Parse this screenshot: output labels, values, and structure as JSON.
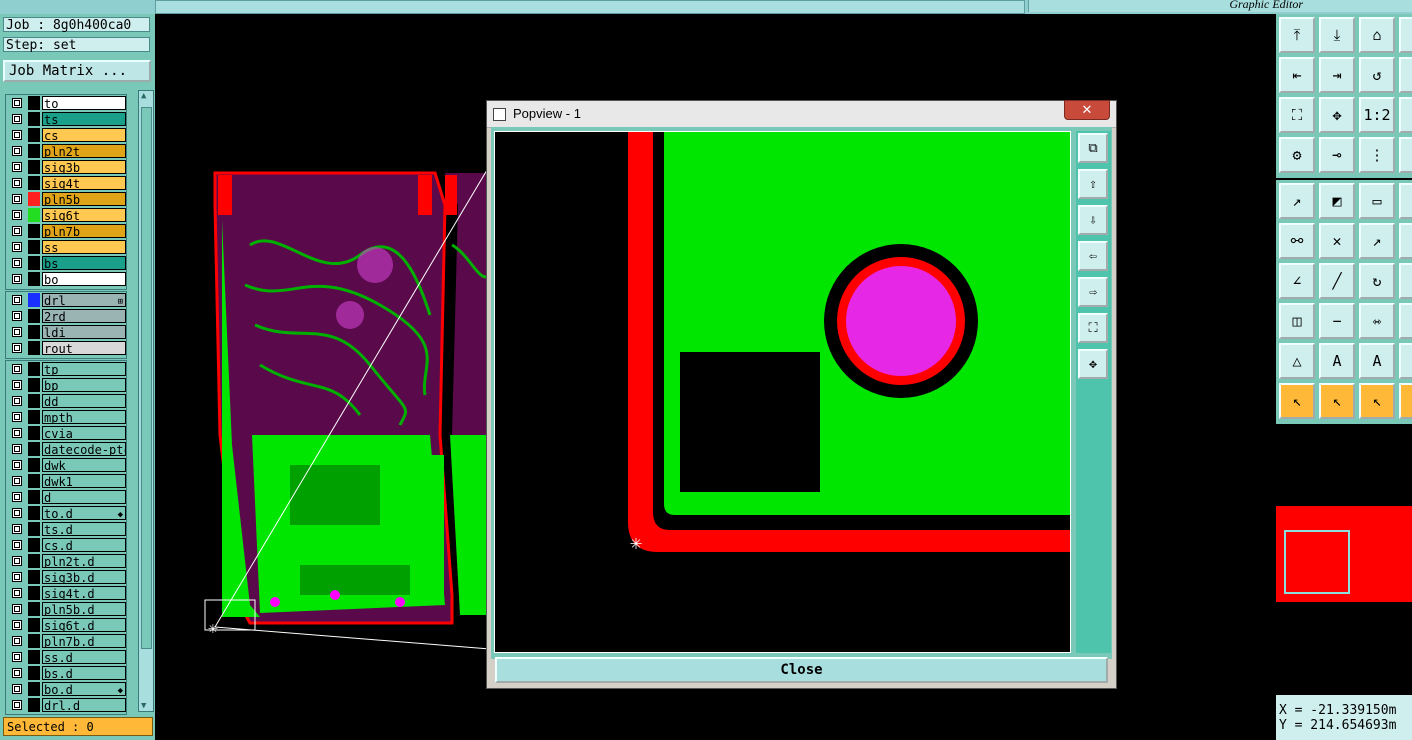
{
  "topbar": {
    "title": "Graphic Editor"
  },
  "left_panel": {
    "job": "Job : 8g0h400ca0",
    "step": "Step: set",
    "job_matrix_button": "Job Matrix ...",
    "layers_top": [
      {
        "name": "to",
        "color": "#ffffff",
        "swatch": "#000000"
      },
      {
        "name": "ts",
        "color": "#1aa08a",
        "swatch": "#000000"
      },
      {
        "name": "cs",
        "color": "#ffc850",
        "swatch": "#000000"
      },
      {
        "name": "pln2t",
        "color": "#e0a418",
        "swatch": "#000000"
      },
      {
        "name": "sig3b",
        "color": "#ffc850",
        "swatch": "#000000"
      },
      {
        "name": "sig4t",
        "color": "#ffc850",
        "swatch": "#000000"
      },
      {
        "name": "pln5b",
        "color": "#e0a418",
        "swatch": "#ff2020"
      },
      {
        "name": "sig6t",
        "color": "#ffc850",
        "swatch": "#22dd22"
      },
      {
        "name": "pln7b",
        "color": "#e0a418",
        "swatch": "#000000"
      },
      {
        "name": "ss",
        "color": "#ffc850",
        "swatch": "#000000"
      },
      {
        "name": "bs",
        "color": "#1aa08a",
        "swatch": "#000000"
      },
      {
        "name": "bo",
        "color": "#ffffff",
        "swatch": "#000000"
      }
    ],
    "layers_drill": [
      {
        "name": "drl",
        "color": "#9ab4b4",
        "swatch": "#1a30ff",
        "mark": "⊞"
      },
      {
        "name": "2rd",
        "color": "#9ab4b4",
        "swatch": "#000000"
      },
      {
        "name": "ldi",
        "color": "#9ab4b4",
        "swatch": "#000000"
      },
      {
        "name": "rout",
        "color": "#d8d8d8",
        "swatch": "#000000"
      }
    ],
    "layers_misc": [
      {
        "name": "tp"
      },
      {
        "name": "bp"
      },
      {
        "name": "dd"
      },
      {
        "name": "mpth"
      },
      {
        "name": "cvia"
      },
      {
        "name": "datecode-ptc"
      },
      {
        "name": "dwk"
      },
      {
        "name": "dwk1"
      },
      {
        "name": "d"
      },
      {
        "name": "to.d",
        "mark": "◆"
      },
      {
        "name": "ts.d"
      },
      {
        "name": "cs.d"
      },
      {
        "name": "pln2t.d"
      },
      {
        "name": "sig3b.d"
      },
      {
        "name": "sig4t.d"
      },
      {
        "name": "pln5b.d"
      },
      {
        "name": "sig6t.d"
      },
      {
        "name": "pln7b.d"
      },
      {
        "name": "ss.d"
      },
      {
        "name": "bs.d"
      },
      {
        "name": "bo.d",
        "mark": "◆"
      },
      {
        "name": "drl.d"
      }
    ],
    "selected": "Selected : 0"
  },
  "popview": {
    "title": "Popview - 1",
    "close_x": "✕",
    "close_button": "Close",
    "colors": {
      "copper": "#00e600",
      "outline": "#ff0000",
      "pad": "#e628e6",
      "void": "#000000"
    }
  },
  "right_panel": {
    "tool_icons": [
      "page-up-icon",
      "page-down-icon",
      "home-icon",
      "edge-icon",
      "page-left-icon",
      "page-right-icon",
      "zoom-back-icon",
      "edge-icon",
      "fit-icon",
      "center-icon",
      "scale-1-2-icon",
      "edge-icon",
      "measure-icon",
      "snap-icon",
      "net-icon",
      "edge-icon",
      "move-icon",
      "mirror-icon",
      "ruler-icon",
      "edge-icon",
      "connect-icon",
      "delete-icon",
      "draw-point-icon",
      "edge-icon",
      "angle-icon",
      "line-icon",
      "rotate-icon",
      "edge-icon",
      "pad-icon",
      "minus-icon",
      "resize-icon",
      "edge-icon",
      "triangle-icon",
      "triangle-a-icon",
      "triangle-b-icon",
      "edge-icon",
      "pointer-icon",
      "pointer-box-icon",
      "pointer-circle-icon",
      "edge-icon"
    ],
    "coord_x": "X = -21.339150m",
    "coord_y": "Y = 214.654693m"
  }
}
